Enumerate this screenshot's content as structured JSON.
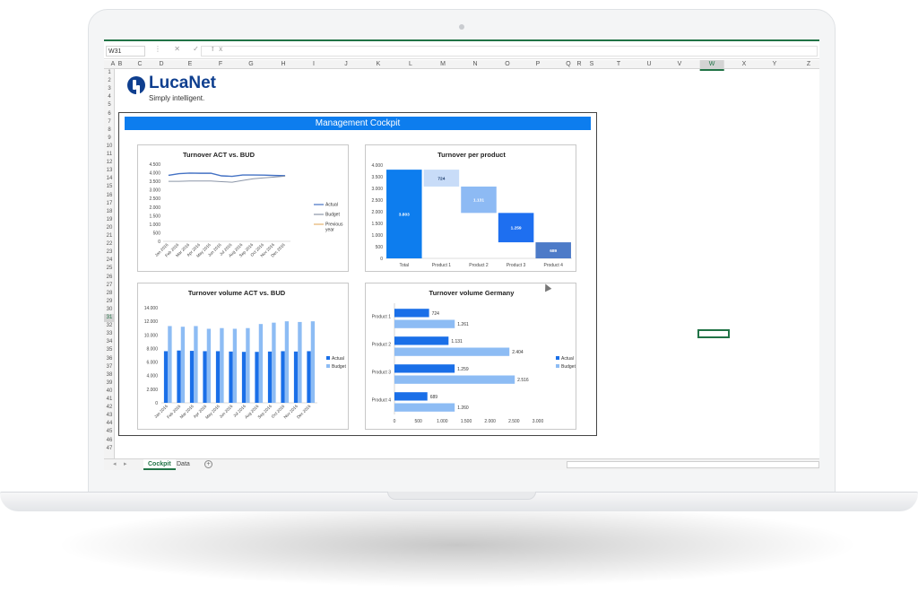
{
  "app": {
    "name_box": "W31",
    "formula_icons": "⋮ ✕ ✓ fx",
    "formula_value": "",
    "columns": [
      "A",
      "B",
      "C",
      "D",
      "E",
      "F",
      "G",
      "H",
      "I",
      "J",
      "K",
      "L",
      "M",
      "N",
      "O",
      "P",
      "Q",
      "R",
      "S",
      "T",
      "U",
      "V",
      "W",
      "X",
      "Y",
      "Z"
    ],
    "selected_column": "W",
    "rows": [
      "1",
      "2",
      "3",
      "4",
      "5",
      "6",
      "7",
      "8",
      "9",
      "10",
      "11",
      "12",
      "13",
      "14",
      "15",
      "16",
      "17",
      "18",
      "19",
      "20",
      "21",
      "22",
      "23",
      "24",
      "25",
      "26",
      "27",
      "28",
      "29",
      "30",
      "31",
      "32",
      "33",
      "34",
      "35",
      "36",
      "37",
      "38",
      "39",
      "40",
      "41",
      "42",
      "43",
      "44",
      "45",
      "46",
      "47"
    ],
    "selected_row": "31",
    "sheet_tabs": [
      {
        "label": "Cockpit",
        "active": true
      },
      {
        "label": "Data",
        "active": false
      }
    ],
    "add_sheet": "+",
    "nav_prev": "◂",
    "nav_next": "▸",
    "scroll_left": "◂",
    "accent_color": "#217346"
  },
  "logo": {
    "name": "LucaNet",
    "tagline": "Simply intelligent."
  },
  "cockpit": {
    "title": "Management Cockpit",
    "title_color": "#0d7dee"
  },
  "chart_data": [
    {
      "type": "line",
      "title": "Turnover ACT vs. BUD",
      "x": [
        "Jan 2016",
        "Feb 2016",
        "Mar 2016",
        "Apr 2016",
        "May 2016",
        "Jun 2016",
        "Jul 2016",
        "Aug 2016",
        "Sep 2016",
        "Oct 2016",
        "Nov 2016",
        "Dec 2016"
      ],
      "yticks": [
        "4.500",
        "4.000",
        "3.500",
        "3.000",
        "2.500",
        "2.000",
        "1.500",
        "1.000",
        "500",
        "0"
      ],
      "ylim": [
        0,
        4500
      ],
      "series": [
        {
          "name": "Actual",
          "color": "#4472c4",
          "values": [
            3850,
            3950,
            3980,
            3970,
            3970,
            3820,
            3790,
            3870,
            3870,
            3860,
            3840,
            3830
          ]
        },
        {
          "name": "Budget",
          "color": "#8c96a8",
          "values": [
            3500,
            3500,
            3520,
            3520,
            3520,
            3480,
            3450,
            3550,
            3650,
            3700,
            3750,
            3800
          ]
        },
        {
          "name": "Previous year",
          "color": "#e4b26e",
          "values": [
            null,
            null,
            null,
            null,
            null,
            null,
            null,
            null,
            null,
            null,
            null,
            null
          ]
        }
      ],
      "legend": "right"
    },
    {
      "type": "bar",
      "subtype": "waterfall",
      "title": "Turnover per product",
      "categories": [
        "Total",
        "Product 1",
        "Product 2",
        "Product 3",
        "Product 4"
      ],
      "values": [
        3803,
        724,
        1131,
        1259,
        689
      ],
      "labels": [
        "3.803",
        "724",
        "1.131",
        "1.259",
        "689"
      ],
      "yticks": [
        "4.000",
        "3.500",
        "3.000",
        "2.500",
        "2.000",
        "1.500",
        "1.000",
        "500",
        "0"
      ],
      "ylim": [
        0,
        4000
      ],
      "colors": [
        "#0d7dee",
        "#c8dcf8",
        "#8dbaf4",
        "#1e6ff0",
        "#4d7bc8"
      ]
    },
    {
      "type": "bar",
      "title": "Turnover volume ACT vs. BUD",
      "categories": [
        "Jan 2016",
        "Feb 2016",
        "Mar 2016",
        "Apr 2016",
        "May 2016",
        "Jun 2016",
        "Jul 2016",
        "Aug 2016",
        "Sep 2016",
        "Oct 2016",
        "Nov 2016",
        "Dec 2016"
      ],
      "yticks": [
        "14.000",
        "12.000",
        "10.000",
        "8.000",
        "6.000",
        "4.000",
        "2.000",
        "0"
      ],
      "ylim": [
        0,
        14000
      ],
      "series": [
        {
          "name": "Actual",
          "color": "#1a6fe8",
          "values": [
            7600,
            7700,
            7650,
            7600,
            7600,
            7550,
            7500,
            7500,
            7550,
            7600,
            7550,
            7600
          ]
        },
        {
          "name": "Budget",
          "color": "#8dbcf4",
          "values": [
            11300,
            11200,
            11300,
            10900,
            11000,
            10900,
            11000,
            11600,
            11800,
            12000,
            11900,
            12000
          ]
        }
      ],
      "legend": "right"
    },
    {
      "type": "bar",
      "orientation": "horizontal",
      "title": "Turnover volume Germany",
      "categories": [
        "Product 1",
        "Product 2",
        "Product 3",
        "Product 4"
      ],
      "xticks": [
        "0",
        "500",
        "1.000",
        "1.500",
        "2.000",
        "2.500",
        "3.000"
      ],
      "xlim": [
        0,
        3000
      ],
      "series": [
        {
          "name": "Actual",
          "color": "#1a6fe8",
          "values": [
            724,
            1131,
            1259,
            689
          ],
          "labels": [
            "724",
            "1.131",
            "1.259",
            "689"
          ]
        },
        {
          "name": "Budget",
          "color": "#8dbcf4",
          "values": [
            1261,
            2404,
            2516,
            1260
          ],
          "labels": [
            "1.261",
            "2.404",
            "2.516",
            "1.260"
          ]
        }
      ],
      "legend": "right"
    }
  ]
}
